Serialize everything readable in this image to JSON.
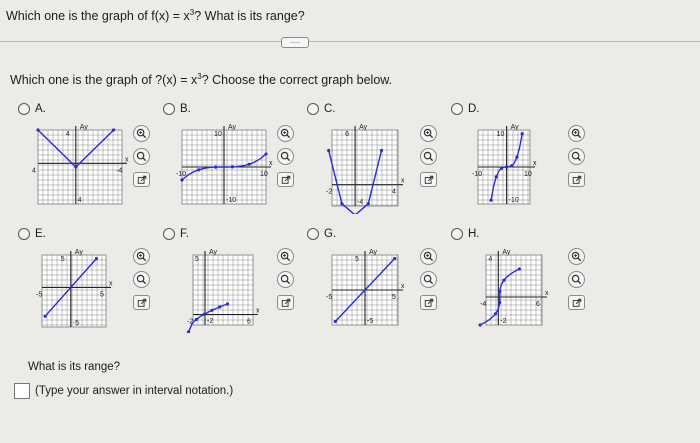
{
  "header": {
    "question_prefix": "Which one is the graph of f(x) = x",
    "question_exp": "3",
    "question_suffix": "? What is its range?"
  },
  "toolbar": {
    "more_label": "....."
  },
  "part1": {
    "prompt_prefix": "Which one is the graph of ?(x) = x",
    "prompt_exp": "3",
    "prompt_suffix": "? Choose the correct graph below."
  },
  "options": [
    {
      "label": "A.",
      "ticks": [
        "4",
        "4",
        "-4",
        "4",
        "Ay",
        "x"
      ]
    },
    {
      "label": "B.",
      "ticks": [
        "10",
        "-10",
        "10",
        "-10",
        "Ay",
        "x"
      ]
    },
    {
      "label": "C.",
      "ticks": [
        "6",
        "-4",
        "4",
        "-2",
        "Ay",
        "x"
      ]
    },
    {
      "label": "D.",
      "ticks": [
        "10",
        "-10",
        "10",
        "-10",
        "Ay",
        "x"
      ]
    },
    {
      "label": "E.",
      "ticks": [
        "5",
        "-5",
        "5",
        "-5",
        "Ay",
        "x"
      ]
    },
    {
      "label": "F.",
      "ticks": [
        "5",
        "-2",
        "6",
        "-2",
        "Ay",
        "x"
      ]
    },
    {
      "label": "G.",
      "ticks": [
        "5",
        "-5",
        "5",
        "-5",
        "Ay",
        "x"
      ]
    },
    {
      "label": "H.",
      "ticks": [
        "4",
        "-2",
        "6",
        "-4",
        "Ay",
        "x"
      ]
    }
  ],
  "part2": {
    "range_question": "What is its range?",
    "answer_hint": "(Type your answer in interval notation.)"
  },
  "colors": {
    "curve": "#2b2bd6",
    "grid": "#7a7a7a",
    "axis": "#222222",
    "background": "#ecebe8"
  },
  "icons": [
    "zoom-in-icon",
    "zoom-out-icon",
    "external-link-icon"
  ]
}
